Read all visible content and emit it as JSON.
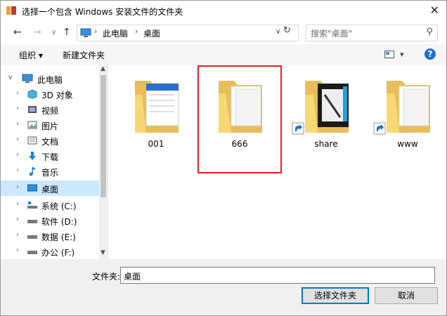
{
  "window": {
    "title": "选择一个包含 Windows 安装文件的文件夹",
    "close_glyph": "✕"
  },
  "nav": {
    "back": "←",
    "forward": "→",
    "recent": "∨",
    "up": "↑",
    "breadcrumb": [
      "此电脑",
      "桌面"
    ],
    "address_dropdown": "∨",
    "refresh": "↻",
    "search_placeholder": "搜索\"桌面\"",
    "search_icon": "search-icon"
  },
  "toolbar": {
    "organize": "组织 ▾",
    "new_folder": "新建文件夹",
    "view_caret": "▾",
    "help": "?"
  },
  "sidebar": {
    "items": [
      {
        "label": "此电脑",
        "icon": "pc-icon",
        "expanded": true
      },
      {
        "label": "3D 对象",
        "icon": "3d-objects-icon"
      },
      {
        "label": "视频",
        "icon": "video-icon"
      },
      {
        "label": "图片",
        "icon": "pictures-icon"
      },
      {
        "label": "文档",
        "icon": "documents-icon"
      },
      {
        "label": "下载",
        "icon": "download-icon"
      },
      {
        "label": "音乐",
        "icon": "music-icon"
      },
      {
        "label": "桌面",
        "icon": "desktop-icon",
        "selected": true
      },
      {
        "label": "系统 (C:)",
        "icon": "system-drive-icon"
      },
      {
        "label": "软件 (D:)",
        "icon": "drive-icon"
      },
      {
        "label": "数据 (E:)",
        "icon": "drive-icon"
      },
      {
        "label": "办公 (F:)",
        "icon": "drive-icon"
      }
    ],
    "collapsed_arrow": "›",
    "expanded_arrow": "∨"
  },
  "folders": [
    {
      "name": "001",
      "type": "folder-with-docs"
    },
    {
      "name": "666",
      "type": "folder",
      "highlighted": true
    },
    {
      "name": "share",
      "type": "shortcut-folder"
    },
    {
      "name": "www",
      "type": "shortcut-folder"
    }
  ],
  "bottom": {
    "folder_label": "文件夹:",
    "folder_value": "桌面",
    "select_button": "选择文件夹",
    "cancel_button": "取消"
  },
  "colors": {
    "accent": "#0078d7",
    "selection": "#cce8ff",
    "highlight_box": "#e02020",
    "folder_yellow": "#f8d775"
  }
}
